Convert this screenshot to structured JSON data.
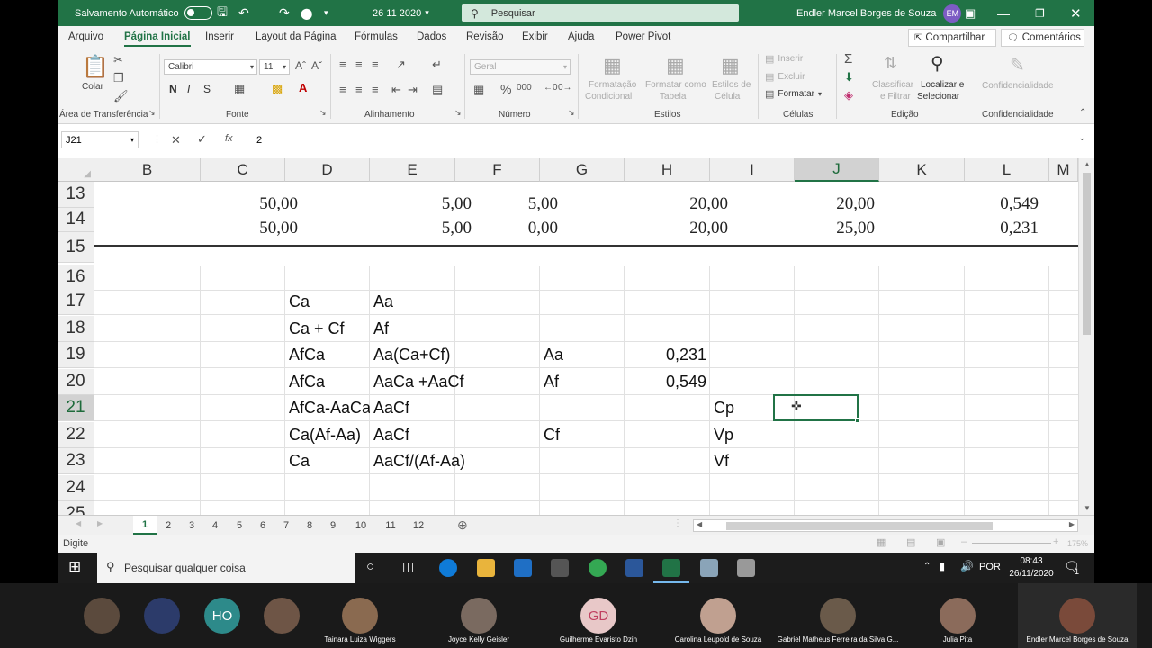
{
  "titlebar": {
    "autosave_label": "Salvamento Automático",
    "filename": "26 11 2020",
    "search_placeholder": "Pesquisar",
    "user_name": "Endler Marcel Borges de Souza",
    "user_initials": "EM"
  },
  "tabs": [
    "Arquivo",
    "Página Inicial",
    "Inserir",
    "Layout da Página",
    "Fórmulas",
    "Dados",
    "Revisão",
    "Exibir",
    "Ajuda",
    "Power Pivot"
  ],
  "share_label": "Compartilhar",
  "comments_label": "Comentários",
  "ribbon": {
    "paste_label": "Colar",
    "clipboard_group": "Área de Transferência",
    "font_name": "Calibri",
    "font_size": "11",
    "font_group": "Fonte",
    "bold": "N",
    "italic": "I",
    "underline": "S",
    "alignment_group": "Alinhamento",
    "number_format": "Geral",
    "number_group": "Número",
    "cond_format_1": "Formatação",
    "cond_format_2": "Condicional",
    "table_format_1": "Formatar como",
    "table_format_2": "Tabela",
    "cell_styles_1": "Estilos de",
    "cell_styles_2": "Célula",
    "styles_group": "Estilos",
    "insert_label": "Inserir",
    "delete_label": "Excluir",
    "format_label": "Formatar",
    "cells_group": "Células",
    "sort_1": "Classificar",
    "sort_2": "e Filtrar",
    "find_1": "Localizar e",
    "find_2": "Selecionar",
    "editing_group": "Edição",
    "sensitivity_label": "Confidencialidade",
    "sensitivity_group": "Confidencialidade"
  },
  "formula_bar": {
    "name_box": "J21",
    "fx": "fx",
    "value": "2"
  },
  "columns": [
    "B",
    "C",
    "D",
    "E",
    "F",
    "G",
    "H",
    "I",
    "J",
    "K",
    "L",
    "M"
  ],
  "selected_column": "J",
  "rows": [
    "13",
    "14",
    "15",
    "16",
    "17",
    "18",
    "19",
    "20",
    "21",
    "22",
    "23",
    "24",
    "25"
  ],
  "selected_row": "21",
  "image_rows": [
    [
      "50,00",
      "5,00",
      "5,00",
      "20,00",
      "20,00",
      "0,549"
    ],
    [
      "50,00",
      "5,00",
      "0,00",
      "20,00",
      "25,00",
      "0,231"
    ]
  ],
  "cells": {
    "D17": "Ca",
    "E17": "Aa",
    "D18": "Ca + Cf",
    "E18": "Af",
    "D19": "AfCa",
    "E19": "Aa(Ca+Cf)",
    "G19": "Aa",
    "H19": "0,231",
    "D20": "AfCa",
    "E20": "AaCa +AaCf",
    "G20": "Af",
    "H20": "0,549",
    "D21": "AfCa-AaCa",
    "E21": "AaCf",
    "I21": "Cp",
    "D22": "Ca(Af-Aa)",
    "E22": "AaCf",
    "G22": "Cf",
    "I22": "Vp",
    "D23": "Ca",
    "E23": "AaCf/(Af-Aa)",
    "I23": "Vf"
  },
  "sheet_tabs": [
    "1",
    "2",
    "3",
    "4",
    "5",
    "6",
    "7",
    "8",
    "9",
    "10",
    "11",
    "12"
  ],
  "active_sheet": "1",
  "status": {
    "mode": "Digite",
    "zoom": "175%"
  },
  "taskbar": {
    "search_placeholder": "Pesquisar qualquer coisa",
    "language": "POR",
    "time": "08:43",
    "date": "26/11/2020",
    "notif_count": "1"
  },
  "participants": [
    {
      "name": "",
      "initials": ""
    },
    {
      "name": "",
      "initials": ""
    },
    {
      "name": "",
      "initials": "HO"
    },
    {
      "name": "",
      "initials": ""
    },
    {
      "name": "Tainara Luiza Wiggers",
      "initials": ""
    },
    {
      "name": "Joyce Kelly Geisler",
      "initials": ""
    },
    {
      "name": "Guilherme Evaristo Dzin",
      "initials": "GD"
    },
    {
      "name": "Carolina Leupold de Souza",
      "initials": ""
    },
    {
      "name": "Gabriel Matheus Ferreira da Silva G...",
      "initials": ""
    },
    {
      "name": "Julia Pita",
      "initials": ""
    },
    {
      "name": "Endler Marcel Borges de Souza",
      "initials": ""
    }
  ]
}
